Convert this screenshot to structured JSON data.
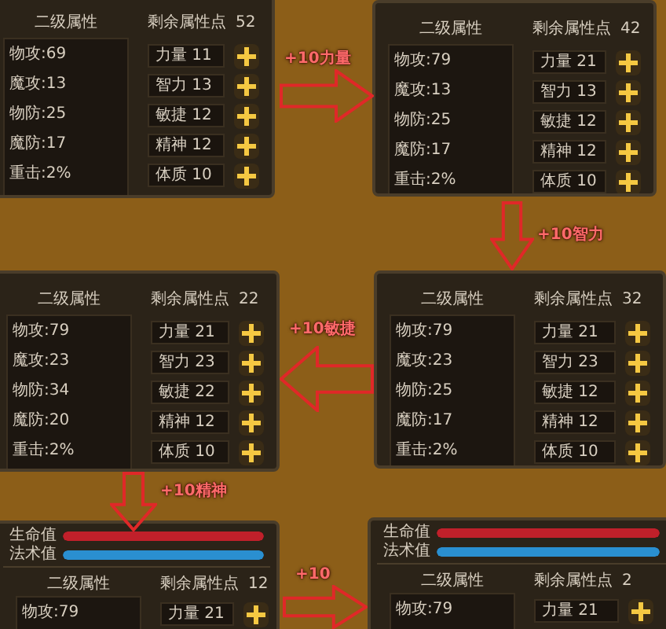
{
  "panels": [
    {
      "title": "二级属性",
      "points_label": "剩余属性点",
      "points": "52",
      "stats": [
        "物攻:69",
        "魔攻:13",
        "物防:25",
        "魔防:17",
        "重击:2%"
      ],
      "attributes": [
        "力量 11",
        "智力 13",
        "敏捷 12",
        "精神 12",
        "体质 10"
      ]
    },
    {
      "title": "二级属性",
      "points_label": "剩余属性点",
      "points": "42",
      "stats": [
        "物攻:79",
        "魔攻:13",
        "物防:25",
        "魔防:17",
        "重击:2%"
      ],
      "attributes": [
        "力量 21",
        "智力 13",
        "敏捷 12",
        "精神 12",
        "体质 10"
      ]
    },
    {
      "title": "二级属性",
      "points_label": "剩余属性点",
      "points": "22",
      "stats": [
        "物攻:79",
        "魔攻:23",
        "物防:34",
        "魔防:20",
        "重击:2%"
      ],
      "attributes": [
        "力量 21",
        "智力 23",
        "敏捷 22",
        "精神 12",
        "体质 10"
      ]
    },
    {
      "title": "二级属性",
      "points_label": "剩余属性点",
      "points": "32",
      "stats": [
        "物攻:79",
        "魔攻:23",
        "物防:25",
        "魔防:17",
        "重击:2%"
      ],
      "attributes": [
        "力量 21",
        "智力 23",
        "敏捷 12",
        "精神 12",
        "体质 10"
      ]
    },
    {
      "title": "二级属性",
      "points_label": "剩余属性点",
      "points": "12",
      "bars": [
        {
          "label": "生命值",
          "kind": "health",
          "level": 1
        },
        {
          "label": "法术值",
          "kind": "mana",
          "level": 1
        }
      ],
      "stats": [
        "物攻:79"
      ],
      "attributes": [
        "力量 21"
      ]
    },
    {
      "title": "二级属性",
      "points_label": "剩余属性点",
      "points": "2",
      "bars": [
        {
          "label": "生命值",
          "kind": "health",
          "level": 1
        },
        {
          "label": "法术值",
          "kind": "mana",
          "level": 1
        }
      ],
      "stats": [
        "物攻:79"
      ],
      "attributes": [
        "力量 21"
      ]
    }
  ],
  "annotations": [
    {
      "label": "+10力量",
      "kind": "right"
    },
    {
      "label": "+10智力",
      "kind": "down"
    },
    {
      "label": "+10敏捷",
      "kind": "left"
    },
    {
      "label": "+10精神",
      "kind": "down"
    },
    {
      "label": "+10",
      "kind": "right"
    }
  ]
}
